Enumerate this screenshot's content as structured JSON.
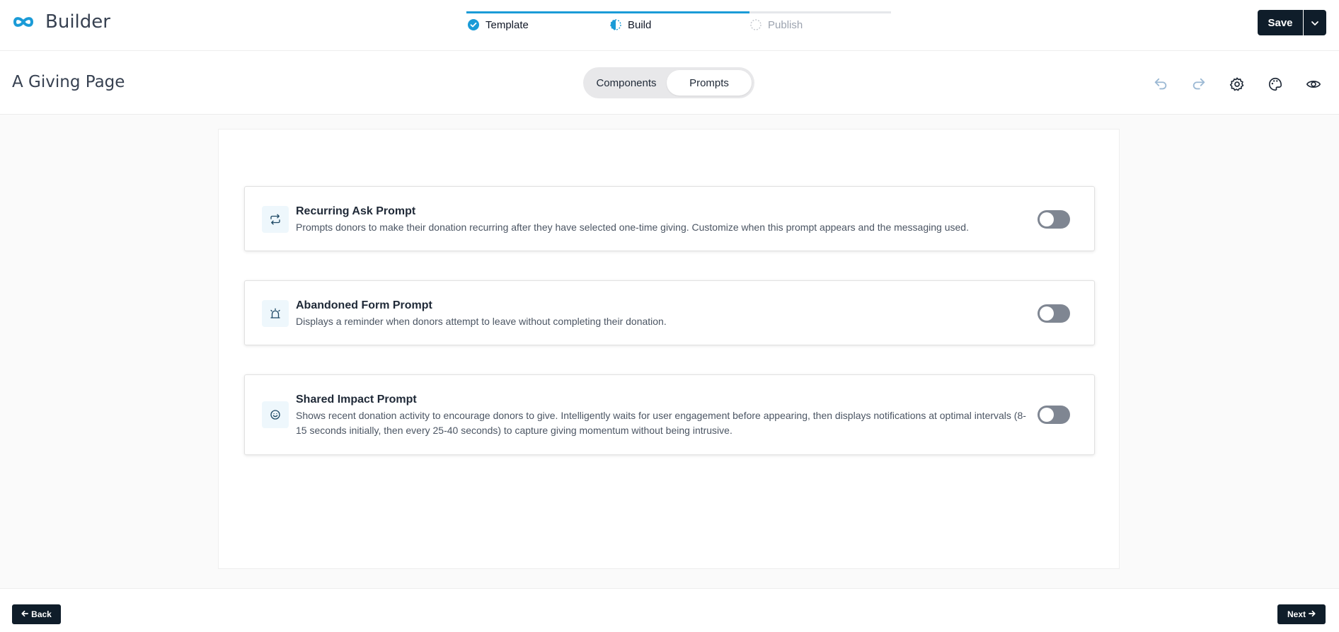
{
  "app": {
    "name": "Builder"
  },
  "steps": [
    {
      "label": "Template",
      "state": "done"
    },
    {
      "label": "Build",
      "state": "current"
    },
    {
      "label": "Publish",
      "state": "pending"
    }
  ],
  "toolbar": {
    "save_label": "Save"
  },
  "page": {
    "title": "A Giving Page"
  },
  "tabs": [
    {
      "label": "Components",
      "selected": false
    },
    {
      "label": "Prompts",
      "selected": true
    }
  ],
  "prompts": [
    {
      "title": "Recurring Ask Prompt",
      "description": "Prompts donors to make their donation recurring after they have selected one-time giving. Customize when this prompt appears and the messaging used.",
      "enabled": false
    },
    {
      "title": "Abandoned Form Prompt",
      "description": "Displays a reminder when donors attempt to leave without completing their donation.",
      "enabled": false
    },
    {
      "title": "Shared Impact Prompt",
      "description": "Shows recent donation activity to encourage donors to give. Intelligently waits for user engagement before appearing, then displays notifications at optimal intervals (8-15 seconds initially, then every 25-40 seconds) to capture giving momentum without being intrusive.",
      "enabled": false
    }
  ],
  "footer": {
    "back_label": "Back",
    "next_label": "Next"
  },
  "colors": {
    "accent": "#1a9bd7",
    "dark": "#0f1d2a",
    "toggle_off": "#7f8692"
  }
}
